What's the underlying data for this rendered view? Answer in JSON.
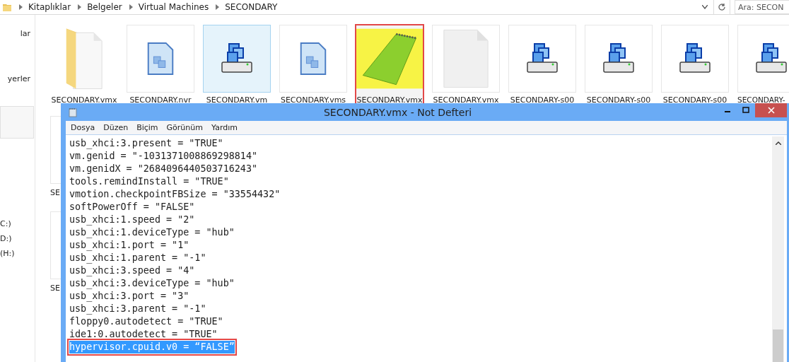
{
  "address_bar": {
    "breadcrumbs": [
      "Kitaplıklar",
      "Belgeler",
      "Virtual Machines",
      "SECONDARY"
    ],
    "search": {
      "placeholder": "Ara: SECON"
    }
  },
  "sidebar": {
    "sections": [
      {
        "items": [
          "lar",
          "yerler"
        ]
      },
      {
        "items": [
          "C:)",
          "D:)",
          "(H:)"
        ]
      }
    ]
  },
  "files": [
    {
      "name": "SECONDARY.vmx",
      "kind": "folder",
      "selected": false,
      "marked": false
    },
    {
      "name": "SECONDARY.nvr",
      "kind": "document",
      "selected": false,
      "marked": false
    },
    {
      "name": "SECONDARY.vm",
      "kind": "vm",
      "selected": true,
      "marked": false
    },
    {
      "name": "SECONDARY.vms",
      "kind": "document",
      "selected": false,
      "marked": false
    },
    {
      "name": "SECONDARY.vmx",
      "kind": "notepad",
      "selected": false,
      "marked": true
    },
    {
      "name": "SECONDARY.vmx",
      "kind": "blank",
      "selected": false,
      "marked": false
    },
    {
      "name": "SECONDARY-s00",
      "kind": "vm",
      "selected": false,
      "marked": false
    },
    {
      "name": "SECONDARY-s00",
      "kind": "vm",
      "selected": false,
      "marked": false
    },
    {
      "name": "SECONDARY-s00",
      "kind": "vm",
      "selected": false,
      "marked": false
    },
    {
      "name": "SECONDARY-",
      "kind": "vm",
      "selected": false,
      "marked": false
    }
  ],
  "files_behind": [
    "SE",
    "SE"
  ],
  "notepad": {
    "title": "SECONDARY.vmx - Not Defteri",
    "menu": [
      "Dosya",
      "Düzen",
      "Biçim",
      "Görünüm",
      "Yardım"
    ],
    "lines": [
      {
        "text": "usb_xhci:3.present = \"TRUE\"",
        "selected": false
      },
      {
        "text": "vm.genid = \"-1031371008869298814\"",
        "selected": false
      },
      {
        "text": "vm.genidX = \"2684096440503716243\"",
        "selected": false
      },
      {
        "text": "tools.remindInstall = \"TRUE\"",
        "selected": false
      },
      {
        "text": "vmotion.checkpointFBSize = \"33554432\"",
        "selected": false
      },
      {
        "text": "softPowerOff = \"FALSE\"",
        "selected": false
      },
      {
        "text": "usb_xhci:1.speed = \"2\"",
        "selected": false
      },
      {
        "text": "usb_xhci:1.deviceType = \"hub\"",
        "selected": false
      },
      {
        "text": "usb_xhci:1.port = \"1\"",
        "selected": false
      },
      {
        "text": "usb_xhci:1.parent = \"-1\"",
        "selected": false
      },
      {
        "text": "usb_xhci:3.speed = \"4\"",
        "selected": false
      },
      {
        "text": "usb_xhci:3.deviceType = \"hub\"",
        "selected": false
      },
      {
        "text": "usb_xhci:3.port = \"3\"",
        "selected": false
      },
      {
        "text": "usb_xhci:3.parent = \"-1\"",
        "selected": false
      },
      {
        "text": "floppy0.autodetect = \"TRUE\"",
        "selected": false
      },
      {
        "text": "ide1:0.autodetect = \"TRUE\"",
        "selected": false
      },
      {
        "text": "hypervisor.cpuid.v0 = “FALSE”",
        "selected": true
      }
    ]
  }
}
